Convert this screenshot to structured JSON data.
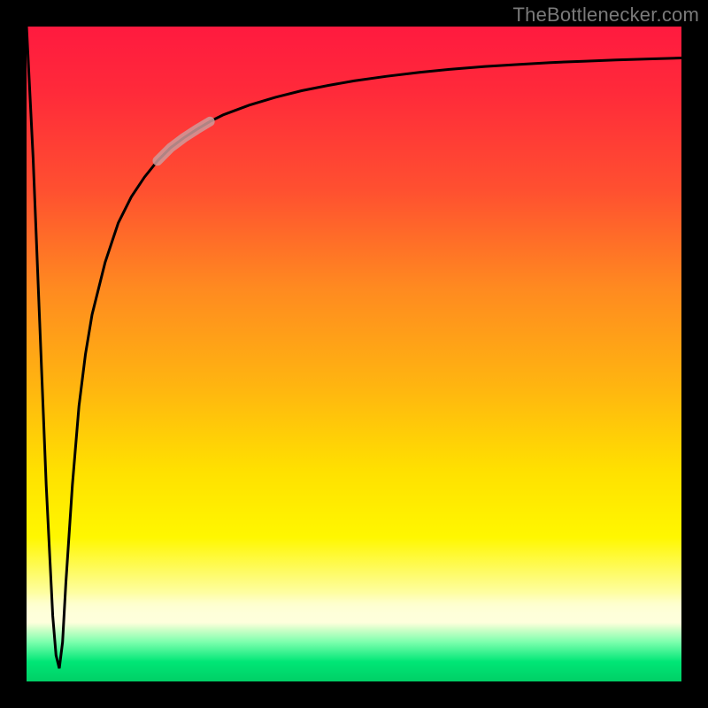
{
  "attribution": "TheBottlenecker.com",
  "colors": {
    "frame": "#000000",
    "gradient_top": "#ff1a3f",
    "gradient_mid1": "#ff8a20",
    "gradient_mid2": "#ffe100",
    "gradient_pale": "#feffd8",
    "gradient_bottom": "#00d066",
    "curve": "#000000",
    "highlight": "#d09090"
  },
  "chart_data": {
    "type": "line",
    "title": "",
    "xlabel": "",
    "ylabel": "",
    "xlim": [
      0,
      100
    ],
    "ylim": [
      0,
      100
    ],
    "grid": false,
    "legend": false,
    "annotations": [
      "TheBottlenecker.com"
    ],
    "series": [
      {
        "name": "bottleneck-curve",
        "x": [
          0,
          1,
          2,
          3,
          4,
          4.5,
          5,
          5.5,
          6,
          7,
          8,
          9,
          10,
          12,
          14,
          16,
          18,
          20,
          22,
          24,
          26,
          28,
          30,
          34,
          38,
          42,
          46,
          50,
          55,
          60,
          65,
          70,
          75,
          80,
          85,
          90,
          95,
          100
        ],
        "y": [
          100,
          80,
          55,
          30,
          10,
          4,
          2,
          6,
          15,
          30,
          42,
          50,
          56,
          64,
          70,
          74,
          77,
          79.5,
          81.5,
          83,
          84.3,
          85.5,
          86.5,
          88,
          89.2,
          90.2,
          91,
          91.7,
          92.4,
          93,
          93.5,
          93.9,
          94.2,
          94.5,
          94.7,
          94.9,
          95.05,
          95.2
        ]
      }
    ],
    "highlight_segment": {
      "series": "bottleneck-curve",
      "x_from": 20,
      "x_to": 28,
      "note": "thick pale segment overlay on curve"
    }
  }
}
